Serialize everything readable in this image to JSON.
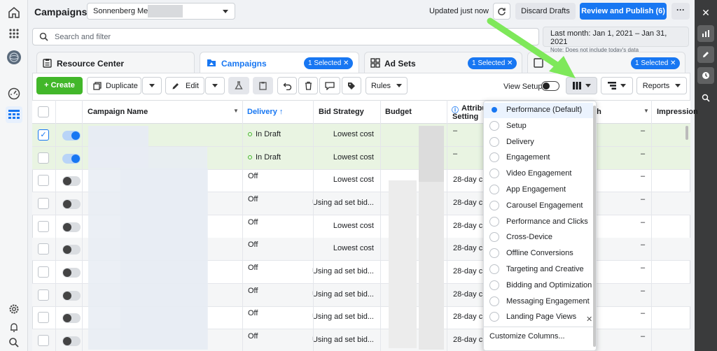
{
  "topbar": {
    "title": "Campaigns",
    "account": "Sonnenberg Media",
    "updated": "Updated just now",
    "discard": "Discard Drafts",
    "publish": "Review and Publish (6)",
    "more": "···"
  },
  "search": {
    "placeholder": "Search and filter"
  },
  "daterange": {
    "range": "Last month: Jan 1, 2021 – Jan 31, 2021",
    "note": "Note: Does not include today's data"
  },
  "tabs": [
    {
      "label": "Resource Center",
      "pill": ""
    },
    {
      "label": "Campaigns",
      "pill": "1 Selected"
    },
    {
      "label": "Ad Sets",
      "pill": "1 Selected"
    },
    {
      "label": "",
      "pill": "1 Selected"
    }
  ],
  "toolbar": {
    "create": "+ Create",
    "duplicate": "Duplicate",
    "edit": "Edit",
    "rules": "Rules",
    "view_setup": "View Setup",
    "reports": "Reports"
  },
  "table": {
    "headers": {
      "name": "Campaign Name",
      "delivery": "Delivery ↑",
      "bid": "Bid Strategy",
      "budget": "Budget",
      "attrib1": "Attribu",
      "attrib2": "Setting",
      "reach": "ch",
      "impressions": "Impression"
    },
    "rows": [
      {
        "checked": true,
        "on": true,
        "delivery": "In Draft",
        "draft": true,
        "bid": "Lowest cost",
        "attrib": "–",
        "reach": "–"
      },
      {
        "checked": false,
        "on": true,
        "delivery": "In Draft",
        "draft": true,
        "bid": "Lowest cost",
        "attrib": "–",
        "reach": "–"
      },
      {
        "checked": false,
        "on": false,
        "delivery": "Off",
        "draft": false,
        "bid": "Lowest cost",
        "attrib": "28-day cli",
        "reach": "–"
      },
      {
        "checked": false,
        "on": false,
        "delivery": "Off",
        "draft": false,
        "bid": "Using ad set bid...",
        "attrib": "28-day cli",
        "reach": "–"
      },
      {
        "checked": false,
        "on": false,
        "delivery": "Off",
        "draft": false,
        "bid": "Lowest cost",
        "attrib": "28-day cli",
        "reach": "–"
      },
      {
        "checked": false,
        "on": false,
        "delivery": "Off",
        "draft": false,
        "bid": "Lowest cost",
        "attrib": "28-day cli",
        "reach": "–"
      },
      {
        "checked": false,
        "on": false,
        "delivery": "Off",
        "draft": false,
        "bid": "Using ad set bid...",
        "attrib": "28-day cli",
        "reach": "–"
      },
      {
        "checked": false,
        "on": false,
        "delivery": "Off",
        "draft": false,
        "bid": "Using ad set bid...",
        "attrib": "28-day cli",
        "reach": "–"
      },
      {
        "checked": false,
        "on": false,
        "delivery": "Off",
        "draft": false,
        "bid": "Using ad set bid...",
        "attrib": "28-day cli",
        "reach": "–"
      },
      {
        "checked": false,
        "on": false,
        "delivery": "Off",
        "draft": false,
        "bid": "Using ad set bid...",
        "attrib": "28-day cli",
        "reach": "–"
      }
    ]
  },
  "columns_menu": {
    "items": [
      "Performance (Default)",
      "Setup",
      "Delivery",
      "Engagement",
      "Video Engagement",
      "App Engagement",
      "Carousel Engagement",
      "Performance and Clicks",
      "Cross-Device",
      "Offline Conversions",
      "Targeting and Creative",
      "Bidding and Optimization",
      "Messaging Engagement",
      "Landing Page Views"
    ],
    "selected": "Performance (Default)",
    "customize": "Customize Columns..."
  },
  "colors": {
    "accent": "#1877f2",
    "create": "#42b72a",
    "arrow": "#7ee85a"
  }
}
